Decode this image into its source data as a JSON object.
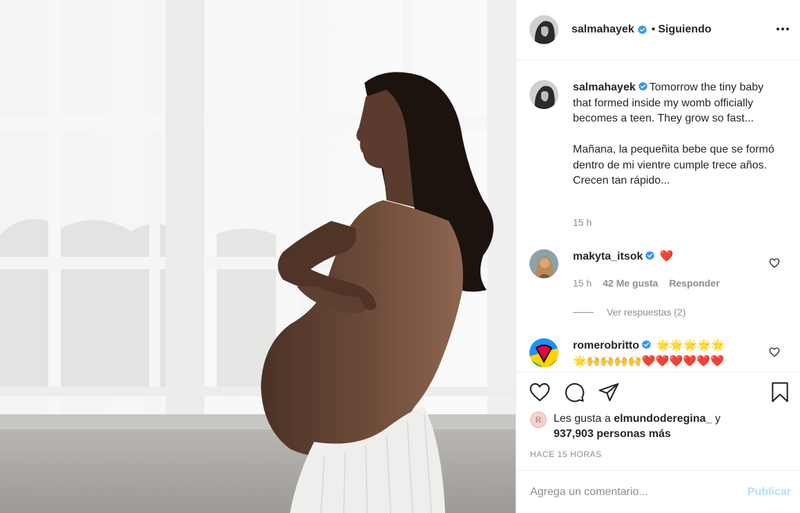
{
  "post": {
    "author": "salmahayek",
    "follow_state": "Siguiendo",
    "dot": "•"
  },
  "caption": {
    "author": "salmahayek",
    "text": "Tomorrow the tiny baby that formed inside my womb officially becomes a teen. They grow so fast...\n\nMañana, la pequeñita bebe que se formó dentro de mi vientre cumple trece años. Crecen tan rápido...",
    "time": "15 h"
  },
  "comments": [
    {
      "author": "makyta_itsok",
      "text": "❤️",
      "time": "15 h",
      "likes": "42 Me gusta",
      "reply": "Responder",
      "view_replies": "Ver respuestas (2)"
    },
    {
      "author": "romerobritto",
      "text": "🌟🌟🌟🌟🌟\n🌟🙌🙌🙌🙌❤️❤️❤️❤️❤️❤️"
    }
  ],
  "likes": {
    "prefix": "Les gusta a",
    "first_user": "elmundoderegina_",
    "connector": "y",
    "others": "937,903 personas más",
    "avatar_letter": "R"
  },
  "time_ago": "HACE 15 HORAS",
  "add_comment": {
    "placeholder": "Agrega un comentario...",
    "publish_label": "Publicar"
  },
  "colors": {
    "verified": "#3897f0",
    "publish_disabled": "#b2dffc",
    "muted": "#8e8e8e",
    "heart_red": "#ed4956"
  }
}
